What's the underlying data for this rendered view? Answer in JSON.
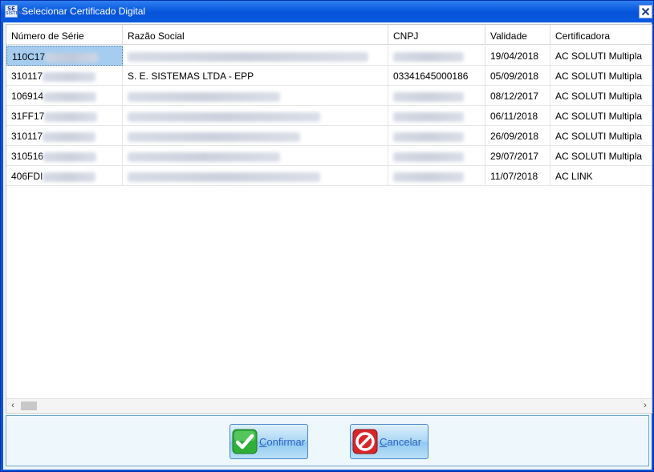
{
  "window": {
    "title": "Selecionar Certificado Digital",
    "icon_text": "SE",
    "icon_subtext": "SISTEMAS"
  },
  "grid": {
    "columns": [
      "Número de Série",
      "Razão Social",
      "CNPJ",
      "Validade",
      "Certificadora"
    ],
    "rows": [
      {
        "serial": "110C17",
        "razao": "",
        "cnpj": "",
        "validade": "19/04/2018",
        "certificadora": "AC SOLUTI Multipla",
        "selected": true
      },
      {
        "serial": "310117",
        "razao": "S. E. SISTEMAS LTDA - EPP",
        "cnpj": "03341645000186",
        "validade": "05/09/2018",
        "certificadora": "AC SOLUTI Multipla",
        "selected": false
      },
      {
        "serial": "106914",
        "razao": "",
        "cnpj": "",
        "validade": "08/12/2017",
        "certificadora": "AC SOLUTI Multipla",
        "selected": false
      },
      {
        "serial": "31FF17",
        "razao": "",
        "cnpj": "",
        "validade": "06/11/2018",
        "certificadora": "AC SOLUTI Multipla",
        "selected": false
      },
      {
        "serial": "310117",
        "razao": "",
        "cnpj": "",
        "validade": "26/09/2018",
        "certificadora": "AC SOLUTI Multipla",
        "selected": false
      },
      {
        "serial": "310516",
        "razao": "",
        "cnpj": "",
        "validade": "29/07/2017",
        "certificadora": "AC SOLUTI Multipla",
        "selected": false
      },
      {
        "serial": "406FDI",
        "razao": "",
        "cnpj": "",
        "validade": "11/07/2018",
        "certificadora": "AC LINK",
        "selected": false
      }
    ]
  },
  "buttons": {
    "confirm": {
      "accel": "C",
      "rest": "onfirmar",
      "icon": "check-icon"
    },
    "cancel": {
      "accel": "C",
      "rest": "ancelar",
      "icon": "cancel-icon"
    }
  },
  "colors": {
    "titlebar": "#0a5be0",
    "selection": "#a6cdf0",
    "button_text": "#2f62c8"
  }
}
